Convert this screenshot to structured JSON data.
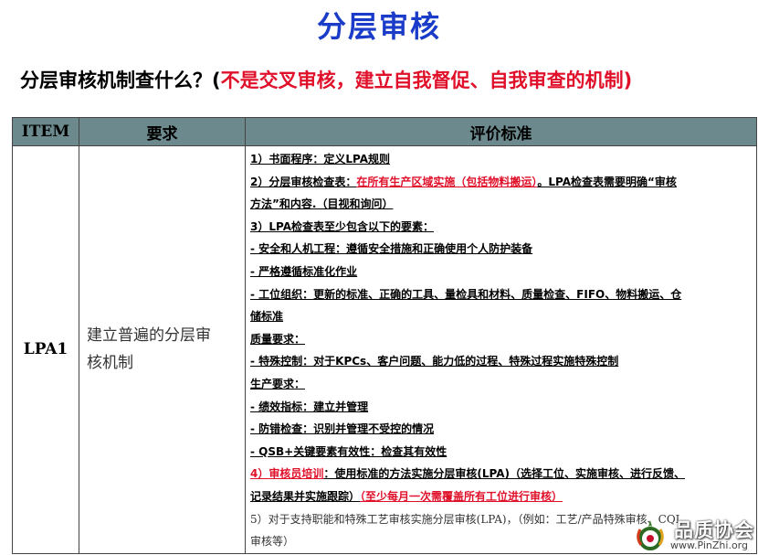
{
  "title": "分层审核",
  "subtitle": {
    "black": "分层审核机制查什么？(",
    "red": "不是交叉审核，建立自我督促、自我审查的机制)"
  },
  "table": {
    "headers": {
      "item": "ITEM",
      "requirement": "要求",
      "criteria": "评价标准"
    },
    "row": {
      "item": "LPA1",
      "requirement_line1": "建立普遍的分层审",
      "requirement_line2": "核机制",
      "criteria": {
        "l1": "1）书面程序：定义LPA规则",
        "l2a": "2）分层审核检查表：",
        "l2b": "在所有生产区域实施（包括物料搬运）",
        "l2c": "。LPA检查表需要明确“审核",
        "l3": "方法”和内容.（目视和询问）",
        "l4": "3）LPA检查表至少包含以下的要素：",
        "l5": "- 安全和人机工程：遵循安全措施和正确使用个人防护装备",
        "l6": "- 严格遵循标准化作业",
        "l7": "- 工位组织：更新的标准、正确的工具、量检具和材料、质量检查、FIFO、物料搬运、仓",
        "l8": "储标准",
        "l9": "质量要求：",
        "l10": "- 特殊控制：对于KPCs、客户问题、能力低的过程、特殊过程实施特殊控制",
        "l11": "生产要求：",
        "l12": "- 绩效指标：建立并管理",
        "l13": "- 防错检查：识别并管理不受控的情况",
        "l14": "- QSB+关键要素有效性：检查其有效性",
        "l15a": "4）",
        "l15b": "审核员培训",
        "l15c": "：使用标准的方法实施分层审核(LPA)（选择工位、实施审核、进行反馈、",
        "l16a": "记录结果并实施跟踪）",
        "l16b": "（至少每月一次需覆盖所有工位进行审核）",
        "l17": "5）对于支持职能和特殊工艺审核实施分层审核(LPA)，（例如：工艺/产品特殊审核、CQI",
        "l18": "审核等）"
      }
    }
  },
  "watermark": {
    "title": "品质协会",
    "url": "www.PinZhi.org"
  },
  "colors": {
    "title": "#1a3cc8",
    "red": "#e0102a",
    "header_bg": "#6c8a8e"
  }
}
